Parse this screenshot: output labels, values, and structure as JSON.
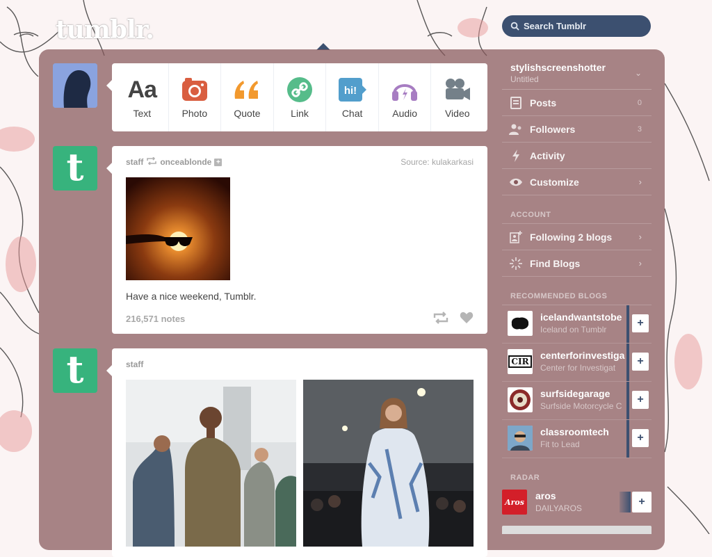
{
  "header": {
    "logo": "tumblr.",
    "search_placeholder": "Search Tumblr"
  },
  "composer": {
    "items": [
      {
        "label": "Text",
        "icon": "text-icon",
        "glyph": "Aa",
        "color": "#444444"
      },
      {
        "label": "Photo",
        "icon": "camera-icon",
        "color": "#d95e40"
      },
      {
        "label": "Quote",
        "icon": "quote-icon",
        "glyph": "“”",
        "color": "#f2992e"
      },
      {
        "label": "Link",
        "icon": "link-icon",
        "color": "#56bc8a"
      },
      {
        "label": "Chat",
        "icon": "chat-icon",
        "glyph": "hi!",
        "color": "#529ecc"
      },
      {
        "label": "Audio",
        "icon": "headphones-icon",
        "color": "#a77dc2"
      },
      {
        "label": "Video",
        "icon": "video-camera-icon",
        "color": "#748089"
      }
    ]
  },
  "posts": [
    {
      "author": "staff",
      "reblogged_from": "onceablonde",
      "source_label": "Source:",
      "source": "kulakarkasi",
      "caption": "Have a nice weekend, Tumblr.",
      "notes": "216,571 notes"
    },
    {
      "author": "staff"
    }
  ],
  "sidebar": {
    "blog_name": "stylishscreenshotter",
    "blog_sub": "Untitled",
    "rows": [
      {
        "label": "Posts",
        "icon": "posts-icon",
        "count": "0"
      },
      {
        "label": "Followers",
        "icon": "followers-icon",
        "count": "3"
      },
      {
        "label": "Activity",
        "icon": "activity-bolt-icon",
        "count": ""
      },
      {
        "label": "Customize",
        "icon": "eye-icon",
        "arrow": "›"
      }
    ],
    "account_header": "ACCOUNT",
    "account_rows": [
      {
        "label": "Following 2 blogs",
        "icon": "following-icon",
        "arrow": "›"
      },
      {
        "label": "Find Blogs",
        "icon": "find-blogs-icon",
        "arrow": "›"
      }
    ],
    "recommended_header": "RECOMMENDED BLOGS",
    "recommended": [
      {
        "name": "icelandwantstobe",
        "sub": "Iceland on Tumblr"
      },
      {
        "name": "centerforinvestiga",
        "sub": "Center for Investigat"
      },
      {
        "name": "surfsidegarage",
        "sub": "Surfside Motorcycle C"
      },
      {
        "name": "classroomtech",
        "sub": "Fit to Lead"
      }
    ],
    "follow_symbol": "+",
    "radar_header": "RADAR",
    "radar": {
      "name": "aros",
      "sub": "DAILYAROS",
      "thumb_text": "Aros"
    }
  },
  "colors": {
    "panel": "#86575a",
    "search_bg": "#3c5070",
    "staff_avatar": "#37b37d",
    "accent_follow": "#3c5070"
  }
}
